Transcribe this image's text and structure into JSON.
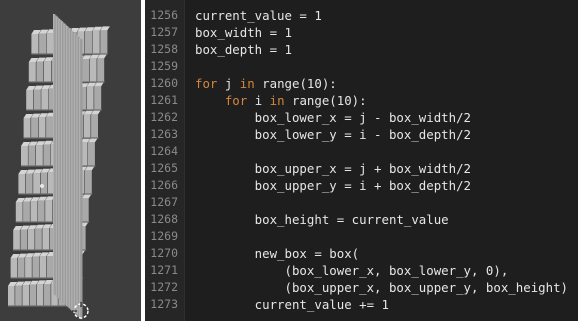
{
  "editor": {
    "lines": [
      {
        "num": "1256",
        "tokens": [
          {
            "t": "current_value = 1",
            "c": "plain"
          }
        ]
      },
      {
        "num": "1257",
        "tokens": [
          {
            "t": "box_width = 1",
            "c": "plain"
          }
        ]
      },
      {
        "num": "1258",
        "tokens": [
          {
            "t": "box_depth = 1",
            "c": "plain"
          }
        ]
      },
      {
        "num": "1259",
        "tokens": []
      },
      {
        "num": "1260",
        "tokens": [
          {
            "t": "for",
            "c": "kw"
          },
          {
            "t": " j ",
            "c": "plain"
          },
          {
            "t": "in",
            "c": "kw"
          },
          {
            "t": " range(10):",
            "c": "plain"
          }
        ]
      },
      {
        "num": "1261",
        "tokens": [
          {
            "t": "    ",
            "c": "plain"
          },
          {
            "t": "for",
            "c": "kw"
          },
          {
            "t": " i ",
            "c": "plain"
          },
          {
            "t": "in",
            "c": "kw"
          },
          {
            "t": " range(10):",
            "c": "plain"
          }
        ]
      },
      {
        "num": "1262",
        "tokens": [
          {
            "t": "        box_lower_x = j - box_width/2",
            "c": "plain"
          }
        ]
      },
      {
        "num": "1263",
        "tokens": [
          {
            "t": "        box_lower_y = i - box_depth/2",
            "c": "plain"
          }
        ]
      },
      {
        "num": "1264",
        "tokens": []
      },
      {
        "num": "1265",
        "tokens": [
          {
            "t": "        box_upper_x = j + box_width/2",
            "c": "plain"
          }
        ]
      },
      {
        "num": "1266",
        "tokens": [
          {
            "t": "        box_upper_y = i + box_depth/2",
            "c": "plain"
          }
        ]
      },
      {
        "num": "1267",
        "tokens": []
      },
      {
        "num": "1268",
        "tokens": [
          {
            "t": "        box_height = current_value",
            "c": "plain"
          }
        ]
      },
      {
        "num": "1269",
        "tokens": []
      },
      {
        "num": "1270",
        "tokens": [
          {
            "t": "        new_box = box(",
            "c": "plain"
          }
        ]
      },
      {
        "num": "1271",
        "tokens": [
          {
            "t": "            (box_lower_x, box_lower_y, 0),",
            "c": "plain"
          }
        ]
      },
      {
        "num": "1272",
        "tokens": [
          {
            "t": "            (box_upper_x, box_upper_y, box_height)",
            "c": "plain"
          }
        ]
      },
      {
        "num": "1273",
        "tokens": [
          {
            "t": "        current_value += 1",
            "c": "plain"
          }
        ]
      }
    ]
  },
  "colors": {
    "editor_bg": "#1e1e1e",
    "keyword": "#d4863d",
    "text": "#e6e6e6",
    "line_number": "#8a8a8a",
    "viewport_bg": "#404040"
  },
  "viewport": {
    "object": "stepped-box-grid-icon",
    "cursor": "3d-cursor-icon"
  }
}
